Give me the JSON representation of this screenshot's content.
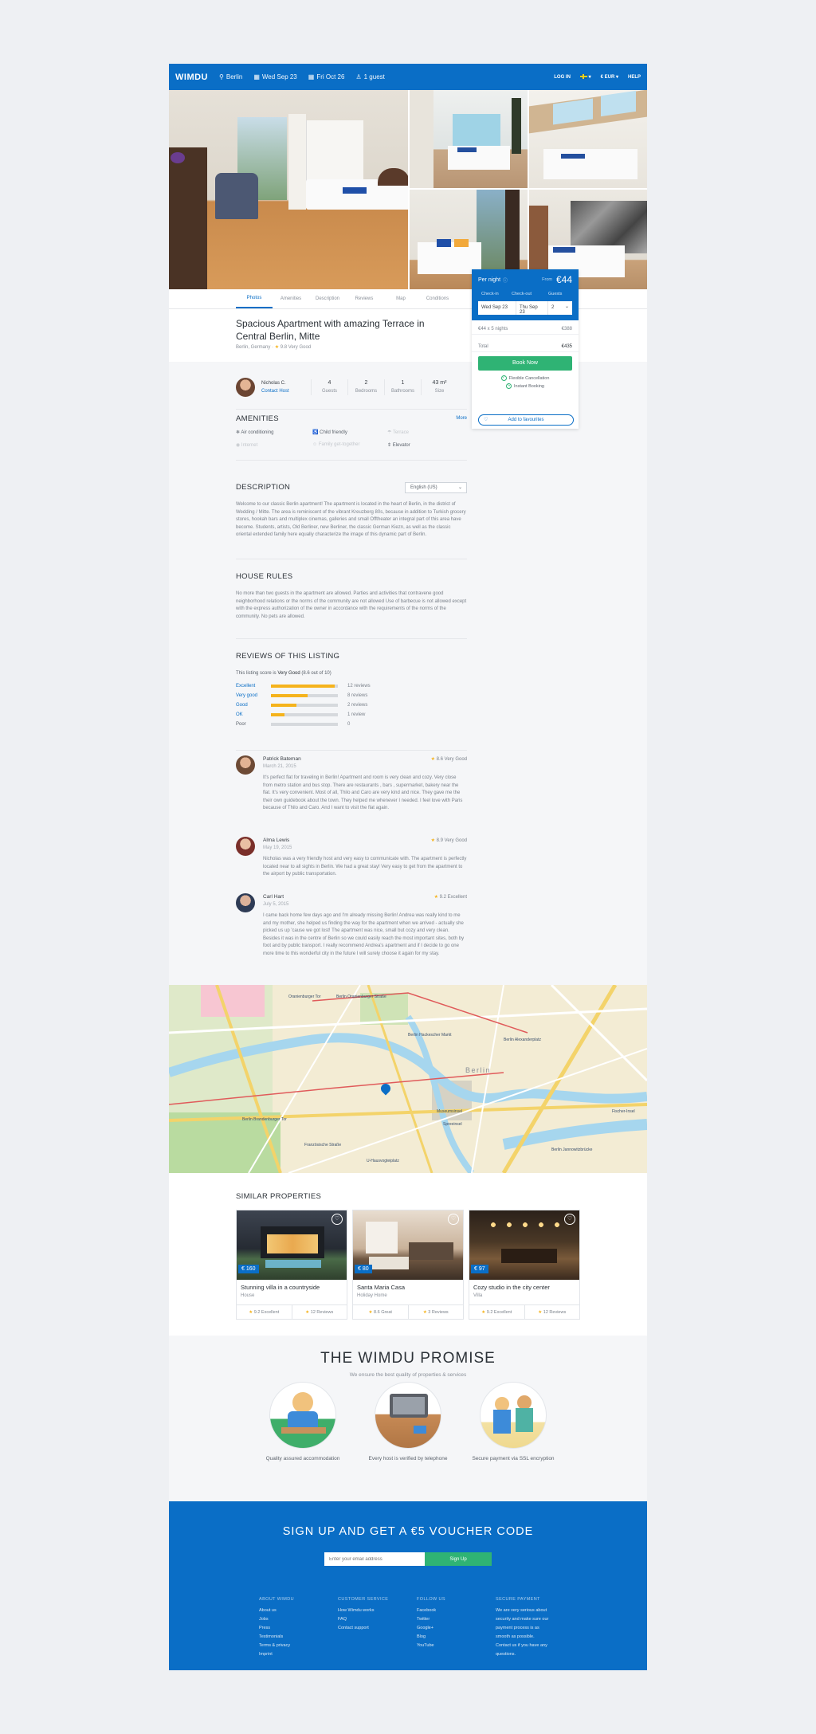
{
  "header": {
    "logo": "WIMDU",
    "city": "Berlin",
    "checkin": "Wed Sep 23",
    "checkout": "Fri Oct 26",
    "guests": "1 guest",
    "login": "LOG IN",
    "currency": "€ EUR",
    "help": "HELP"
  },
  "tabs": [
    "Photos",
    "Amenities",
    "Description",
    "Reviews",
    "Map",
    "Conditions"
  ],
  "listing": {
    "title": "Spacious Apartment with amazing Terrace in Central Berlin, Mitte",
    "location": "Berlin, Germany",
    "rating": "9.8 Very Good"
  },
  "host": {
    "name": "Nicholas C.",
    "contact": "Contact Host"
  },
  "stats": [
    {
      "value": "4",
      "label": "Guests"
    },
    {
      "value": "2",
      "label": "Bedrooms"
    },
    {
      "value": "1",
      "label": "Bathrooms"
    },
    {
      "value": "43 m²",
      "label": "Size"
    }
  ],
  "amenities": {
    "title": "AMENITIES",
    "more": "More",
    "items": [
      {
        "label": "Air conditioning",
        "available": true
      },
      {
        "label": "Child friendly",
        "available": true
      },
      {
        "label": "Terrace",
        "available": false
      },
      {
        "label": "Internet",
        "available": false
      },
      {
        "label": "Family get-together",
        "available": false
      },
      {
        "label": "Elevator",
        "available": true
      }
    ]
  },
  "description": {
    "title": "DESCRIPTION",
    "language": "English (US)",
    "text": "Welcome to our classic Berlin apartment! The apartment is located in the heart of Berlin, in the district of Wedding / Mitte. The area is reminiscent of the vibrant Kreuzberg 80s, because in addition to Turkish grocery stores, hookah bars and multiplex cinemas, galleries and small Offtheater an integral part of this area have become. Students, artists, Old Berliner, new Berliner, the classic German Kiezn, as well as the classic oriental extended family here equally characterize the image of this dynamic part of Berlin."
  },
  "house_rules": {
    "title": "HOUSE RULES",
    "text": "No more than two guests in the apartment are allowed. Parties and activities that contravene good neighborhood relations or the norms of the community are not allowed Use of barbecue is not allowed except with the express authorization of the owner in accordance with the requirements of the norms of the community. No pets are allowed."
  },
  "reviews": {
    "title": "REVIEWS OF THIS LISTING",
    "score_prefix": "This listing score is ",
    "score_word": "Very Good",
    "score_suffix": " (8.6 out of 10)",
    "breakdown": [
      {
        "label": "Excellent",
        "fraction": 0.95,
        "count": "12 reviews"
      },
      {
        "label": "Very good",
        "fraction": 0.55,
        "count": "8 reviews"
      },
      {
        "label": "Good",
        "fraction": 0.38,
        "count": "2 reviews"
      },
      {
        "label": "OK",
        "fraction": 0.2,
        "count": "1 review"
      },
      {
        "label": "Poor",
        "fraction": 0,
        "count": "0"
      }
    ],
    "items": [
      {
        "name": "Patrick Bateman",
        "date": "March 21, 2015",
        "score": "8.6 Very Good",
        "text": "It's perfect flat for traveling in Berlin! Apartment and room is very clean and cozy. Very close from metro station and bus stop. There are restaurants , bars , supermarket, bakery near the flat. It's very convenient. Most of all, Thilo and Caro are very kind and nice. They gave me the their own guidebook about the town. They helped me whenever I needed. I feel love with Paris because of Thilo and Caro. And I want to visit the flat again."
      },
      {
        "name": "Alma Lewis",
        "date": "May 19, 2015",
        "score": "8.9 Very Good",
        "text": "Nicholas was a very friendly host and very easy to communicate with. The apartment is perfectly located near to all sights in Berlin. We had a great stay! Very easy to get from the apartment to the airport by public transportation."
      },
      {
        "name": "Carl Hart",
        "date": "July 5, 2015",
        "score": "9.2 Excellent",
        "text": "I came back home few days ago and I'm already missing Berlin! Andrea was really kind to me and my mother, she helped us finding the way for the apartment when we arrived - actually she picked us up 'cause we got lost! The apartment was nice, small but cozy and very clean. Besides it was in the centre of Berlin so we could easily reach the most important sites, both by foot and by public transport. I really recommend Andrea's apartment and if I decide to go one more time to this wonderful city in the future I will surely choose it again for my stay."
      }
    ]
  },
  "map": {
    "labels": [
      "Oranienburger Tor",
      "Berlin Oranienburger Straße",
      "Berlin Hackescher Markt",
      "Berlin Alexanderplatz",
      "Berlin",
      "Museumsinsel",
      "Spreeinsel",
      "Berlin Brandenburger Tor",
      "Französische Straße",
      "U-Hausvogteiplatz",
      "Berlin Jannowitzbrücke",
      "Fischer-Insel"
    ]
  },
  "similar": {
    "title": "SIMILAR PROPERTIES",
    "items": [
      {
        "price": "€ 160",
        "title": "Stunning villa in a countryside",
        "type": "House",
        "rating": "9.2 Excellent",
        "reviews": "12 Reviews"
      },
      {
        "price": "€ 80",
        "title": "Santa Maria Casa",
        "type": "Holiday Home",
        "rating": "8.6 Great",
        "reviews": "3 Reviews"
      },
      {
        "price": "€ 97",
        "title": "Cozy studio in the city center",
        "type": "Villa",
        "rating": "9.2 Excellent",
        "reviews": "12 Reviews"
      }
    ]
  },
  "promise": {
    "title": "THE WIMDU PROMISE",
    "subtitle": "We ensure the best quality of properties & services",
    "items": [
      "Quality assured accommodation",
      "Every host is verified by telephone",
      "Secure payment via SSL encryption"
    ]
  },
  "footer": {
    "title": "SIGN UP AND GET A €5 VOUCHER CODE",
    "placeholder": "Enter your email address",
    "signup": "Sign Up",
    "columns": [
      {
        "heading": "ABOUT WIMDU",
        "links": [
          "About us",
          "Jobs",
          "Press",
          "Testimonials",
          "Terms & privacy",
          "Imprint"
        ]
      },
      {
        "heading": "CUSTOMER SERVICE",
        "links": [
          "How Wimdu works",
          "FAQ",
          "Contact support"
        ]
      },
      {
        "heading": "FOLLOW US",
        "links": [
          "Facebook",
          "Twitter",
          "Google+",
          "Blog",
          "YouTube"
        ]
      },
      {
        "heading": "SECURE PAYMENT",
        "links": [
          "We are very serious about",
          "security and make sure our",
          "payment process is as",
          "smooth as possible.",
          "Contact us if you have any",
          "questions."
        ]
      }
    ]
  },
  "booking": {
    "per_night": "Per night",
    "from": "From",
    "price": "€44",
    "checkin_label": "Check-in",
    "checkout_label": "Check-out",
    "guests_label": "Guests",
    "checkin": "Wed Sep 23",
    "checkout": "Thu Sep 23",
    "guests": "2",
    "nights_line": "€44 x 5 nights",
    "nights_total": "€388",
    "total_label": "Total",
    "total": "€435",
    "book": "Book Now",
    "flexible": "Flexible Cancellation",
    "instant": "Instant Booking",
    "favourite": "Add to favourites"
  },
  "colors": {
    "brand": "#0a6ec6",
    "accent": "#2fb374",
    "star": "#f5b31c"
  }
}
